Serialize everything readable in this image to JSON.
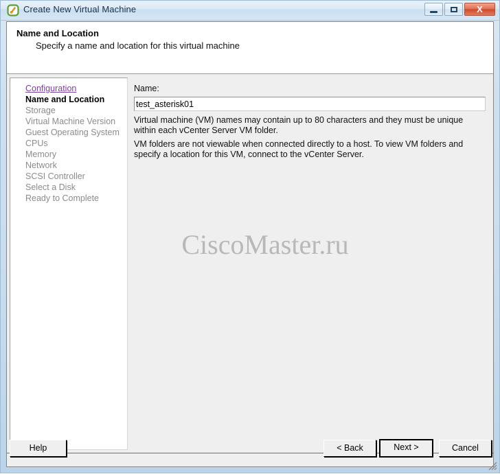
{
  "window": {
    "title": "Create New Virtual Machine",
    "icon": "vm-app-icon",
    "controls": {
      "minimize": "Minimize",
      "maximize": "Maximize",
      "close": "Close",
      "close_glyph": "X"
    }
  },
  "header": {
    "title": "Name and Location",
    "subtitle": "Specify a name and location for this virtual machine"
  },
  "sidebar": {
    "items": [
      {
        "label": "Configuration",
        "state": "link"
      },
      {
        "label": "Name and Location",
        "state": "current"
      },
      {
        "label": "Storage",
        "state": "pending"
      },
      {
        "label": "Virtual Machine Version",
        "state": "pending"
      },
      {
        "label": "Guest Operating System",
        "state": "pending"
      },
      {
        "label": "CPUs",
        "state": "pending"
      },
      {
        "label": "Memory",
        "state": "pending"
      },
      {
        "label": "Network",
        "state": "pending"
      },
      {
        "label": "SCSI Controller",
        "state": "pending"
      },
      {
        "label": "Select a Disk",
        "state": "pending"
      },
      {
        "label": "Ready to Complete",
        "state": "pending"
      }
    ]
  },
  "main": {
    "name_label": "Name:",
    "name_value": "test_asterisk01",
    "name_placeholder": "",
    "paragraph_1": "Virtual machine (VM) names may contain up to 80 characters and they must be unique within each vCenter Server VM folder.",
    "paragraph_2": "VM folders are not viewable when connected directly to a host. To view VM folders and specify a location for this VM, connect to the vCenter Server.",
    "watermark": "CiscoMaster.ru"
  },
  "footer": {
    "help_label": "Help",
    "back_label": "< Back",
    "next_label": "Next >",
    "cancel_label": "Cancel"
  },
  "colors": {
    "link": "#7b3f9d",
    "pending_text": "#8b8b8b",
    "dialog_background": "#efefef",
    "header_background": "#ffffff",
    "titlebar_accent": "#cadff0",
    "close_button": "#cf4a2c",
    "watermark": "#b8b8b8"
  }
}
